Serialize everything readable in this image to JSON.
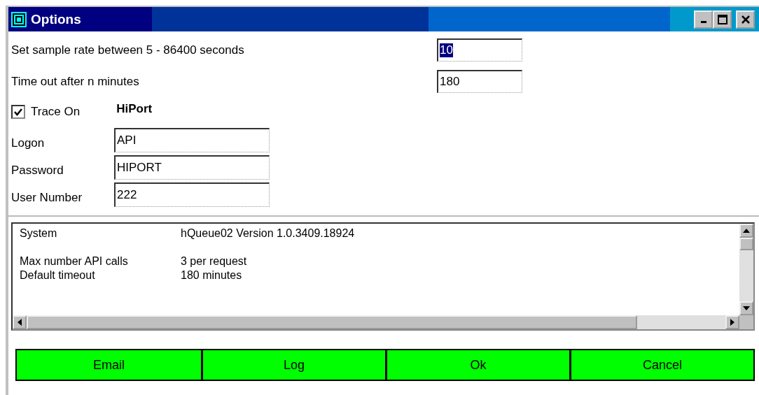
{
  "window": {
    "title": "Options"
  },
  "settings": [
    {
      "label": "Set sample rate between 5 - 86400 seconds",
      "value": "10",
      "highlighted": true
    },
    {
      "label": "Time out after n minutes",
      "value": "180",
      "highlighted": false
    }
  ],
  "trace": {
    "label": "Trace On",
    "checked": true
  },
  "section_title": "HiPort",
  "credentials": [
    {
      "label": "Logon",
      "value": "API"
    },
    {
      "label": "Password",
      "value": "HIPORT"
    },
    {
      "label": "User Number",
      "value": "222"
    }
  ],
  "info_list": [
    {
      "name": "System",
      "value": "hQueue02 Version 1.0.3409.18924"
    },
    {
      "name": "Max number API calls",
      "value": "3 per request"
    },
    {
      "name": "Default timeout",
      "value": "180 minutes"
    }
  ],
  "buttons": [
    "Email",
    "Log",
    "Ok",
    "Cancel"
  ]
}
